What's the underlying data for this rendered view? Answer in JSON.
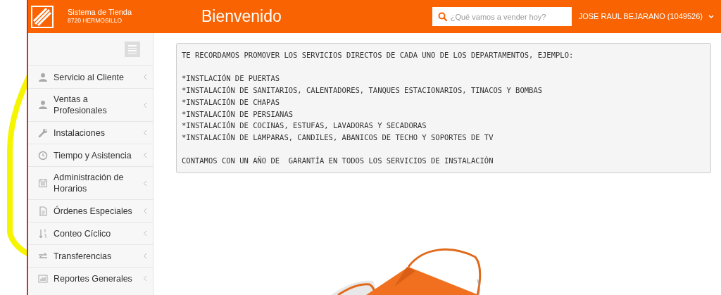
{
  "header": {
    "system_name": "Sistema de Tienda",
    "store": "8720 HERMOSILLO",
    "title": "Bienvenido",
    "search": {
      "placeholder": "¿Qué vamos a vender hoy?"
    },
    "user": "JOSE RAUL BEJARANO (1049526)"
  },
  "sidebar": {
    "items": [
      {
        "label": "Servicio al Cliente",
        "expanded": false
      },
      {
        "label": "Ventas a Profesionales",
        "expanded": false
      },
      {
        "label": "Instalaciones",
        "expanded": false
      },
      {
        "label": "Tiempo y Asistencia",
        "expanded": false
      },
      {
        "label": "Administración de Horarios",
        "expanded": false
      },
      {
        "label": "Órdenes Especiales",
        "expanded": false
      },
      {
        "label": "Conteo Cíclico",
        "expanded": false
      },
      {
        "label": "Transferencias",
        "expanded": false
      },
      {
        "label": "Reportes Generales",
        "expanded": false
      }
    ]
  },
  "message": {
    "paragraphs": [
      [
        "TE RECORDAMOS PROMOVER LOS SERVICIOS DIRECTOS DE CADA UNO DE LOS DEPARTAMENTOS, EJEMPLO:"
      ],
      [
        "*INSTLACIÓN DE PUERTAS",
        "*INSTALACIÓN DE SANITARIOS, CALENTADORES, TANQUES ESTACIONARIOS, TINACOS Y BOMBAS",
        "*INSTALACIÓN DE CHAPAS",
        "*INSTALACIÓN DE PERSIANAS",
        "*INSTALACIÓN DE COCINAS, ESTUFAS, LAVADORAS Y SECADORAS",
        "*INSTALACIÓN DE LAMPARAS, CANDILES, ABANICOS DE TECHO Y SOPORTES DE TV"
      ],
      [
        "CONTAMOS CON UN AÑO DE  GARANTÍA EN TODOS LOS SERVICIOS DE INSTALACIÓN"
      ]
    ]
  }
}
